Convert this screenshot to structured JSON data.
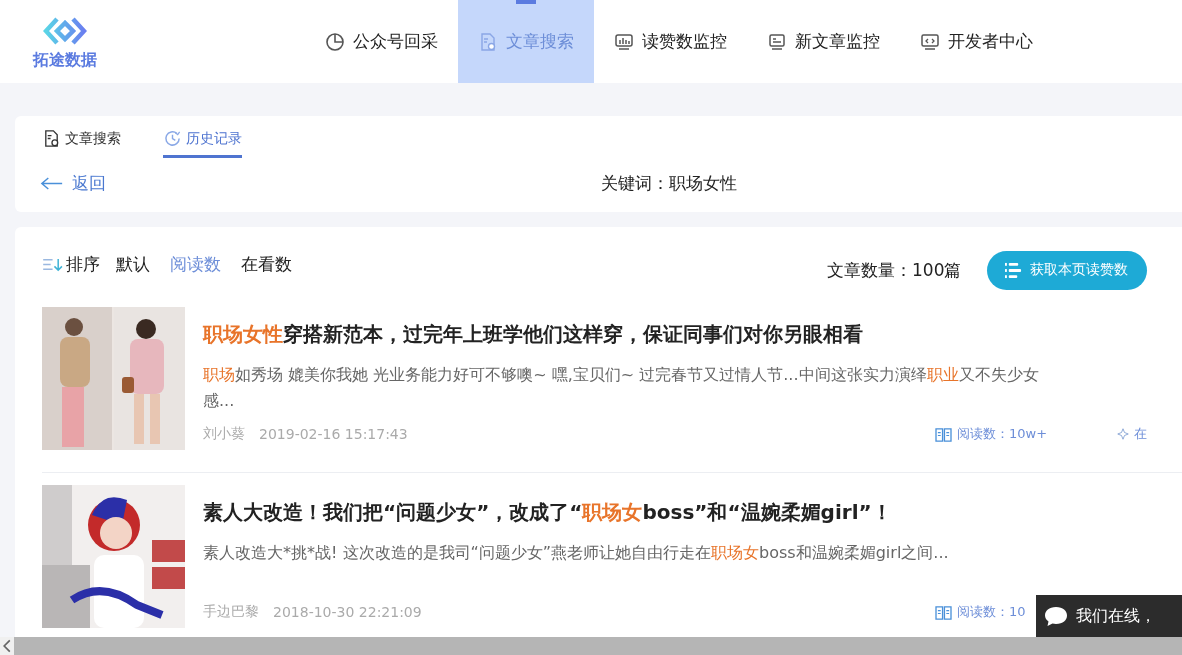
{
  "logo": {
    "text": "拓途数据"
  },
  "nav": [
    {
      "label": "公众号回采",
      "selected": false
    },
    {
      "label": "文章搜索",
      "selected": true
    },
    {
      "label": "读赞数监控",
      "selected": false
    },
    {
      "label": "新文章监控",
      "selected": false
    },
    {
      "label": "开发者中心",
      "selected": false
    }
  ],
  "subtabs": [
    {
      "label": "文章搜索",
      "selected": false
    },
    {
      "label": "历史记录",
      "selected": true
    }
  ],
  "back": {
    "label": "返回"
  },
  "keyword": "关键词：职场女性",
  "sort": {
    "label": "排序",
    "options": [
      {
        "label": "默认",
        "selected": false
      },
      {
        "label": "阅读数",
        "selected": true
      },
      {
        "label": "在看数",
        "selected": false
      }
    ]
  },
  "count": "文章数量：100篇",
  "fetch_button": "获取本页读赞数",
  "articles": [
    {
      "thumbnail": {
        "kind": "picture"
      },
      "title": [
        {
          "text": "职场女性",
          "highlight": true
        },
        {
          "text": "穿搭新范本，过完年上班学他们这样穿，保证同事们对你另眼相看",
          "highlight": false
        }
      ],
      "summary": [
        {
          "text": "职场",
          "highlight": true
        },
        {
          "text": "如秀场 媲美你我她 光业务能力好可不够噢~ 嘿,宝贝们~ 过完春节又过情人节...中间这张实力演绎",
          "highlight": false
        },
        {
          "text": "职业",
          "highlight": true
        },
        {
          "text": "又不失少女感...",
          "highlight": false
        }
      ],
      "author": "刘小葵",
      "date": "2019-02-16 15:17:43",
      "stats": [
        {
          "kind": "reads",
          "text": "阅读数：10w+"
        },
        {
          "kind": "watching",
          "text": "在"
        }
      ]
    },
    {
      "thumbnail": {
        "kind": "picture"
      },
      "title": [
        {
          "text": "素人大改造！我们把“问题少女”，改成了“",
          "highlight": false
        },
        {
          "text": "职场女",
          "highlight": true
        },
        {
          "text": "boss”和“温婉柔媚girl”！",
          "highlight": false
        }
      ],
      "summary": [
        {
          "text": "素人改造大*挑*战! 这次改造的是我司“问题少女”燕老师让她自由行走在",
          "highlight": false
        },
        {
          "text": "职场女",
          "highlight": true
        },
        {
          "text": "boss和温婉柔媚girl之间...",
          "highlight": false
        }
      ],
      "author": "手边巴黎",
      "date": "2018-10-30 22:21:09",
      "stats": [
        {
          "kind": "reads",
          "text": "阅读数：10"
        }
      ]
    }
  ],
  "chat_widget": {
    "text": "我们在线，"
  }
}
